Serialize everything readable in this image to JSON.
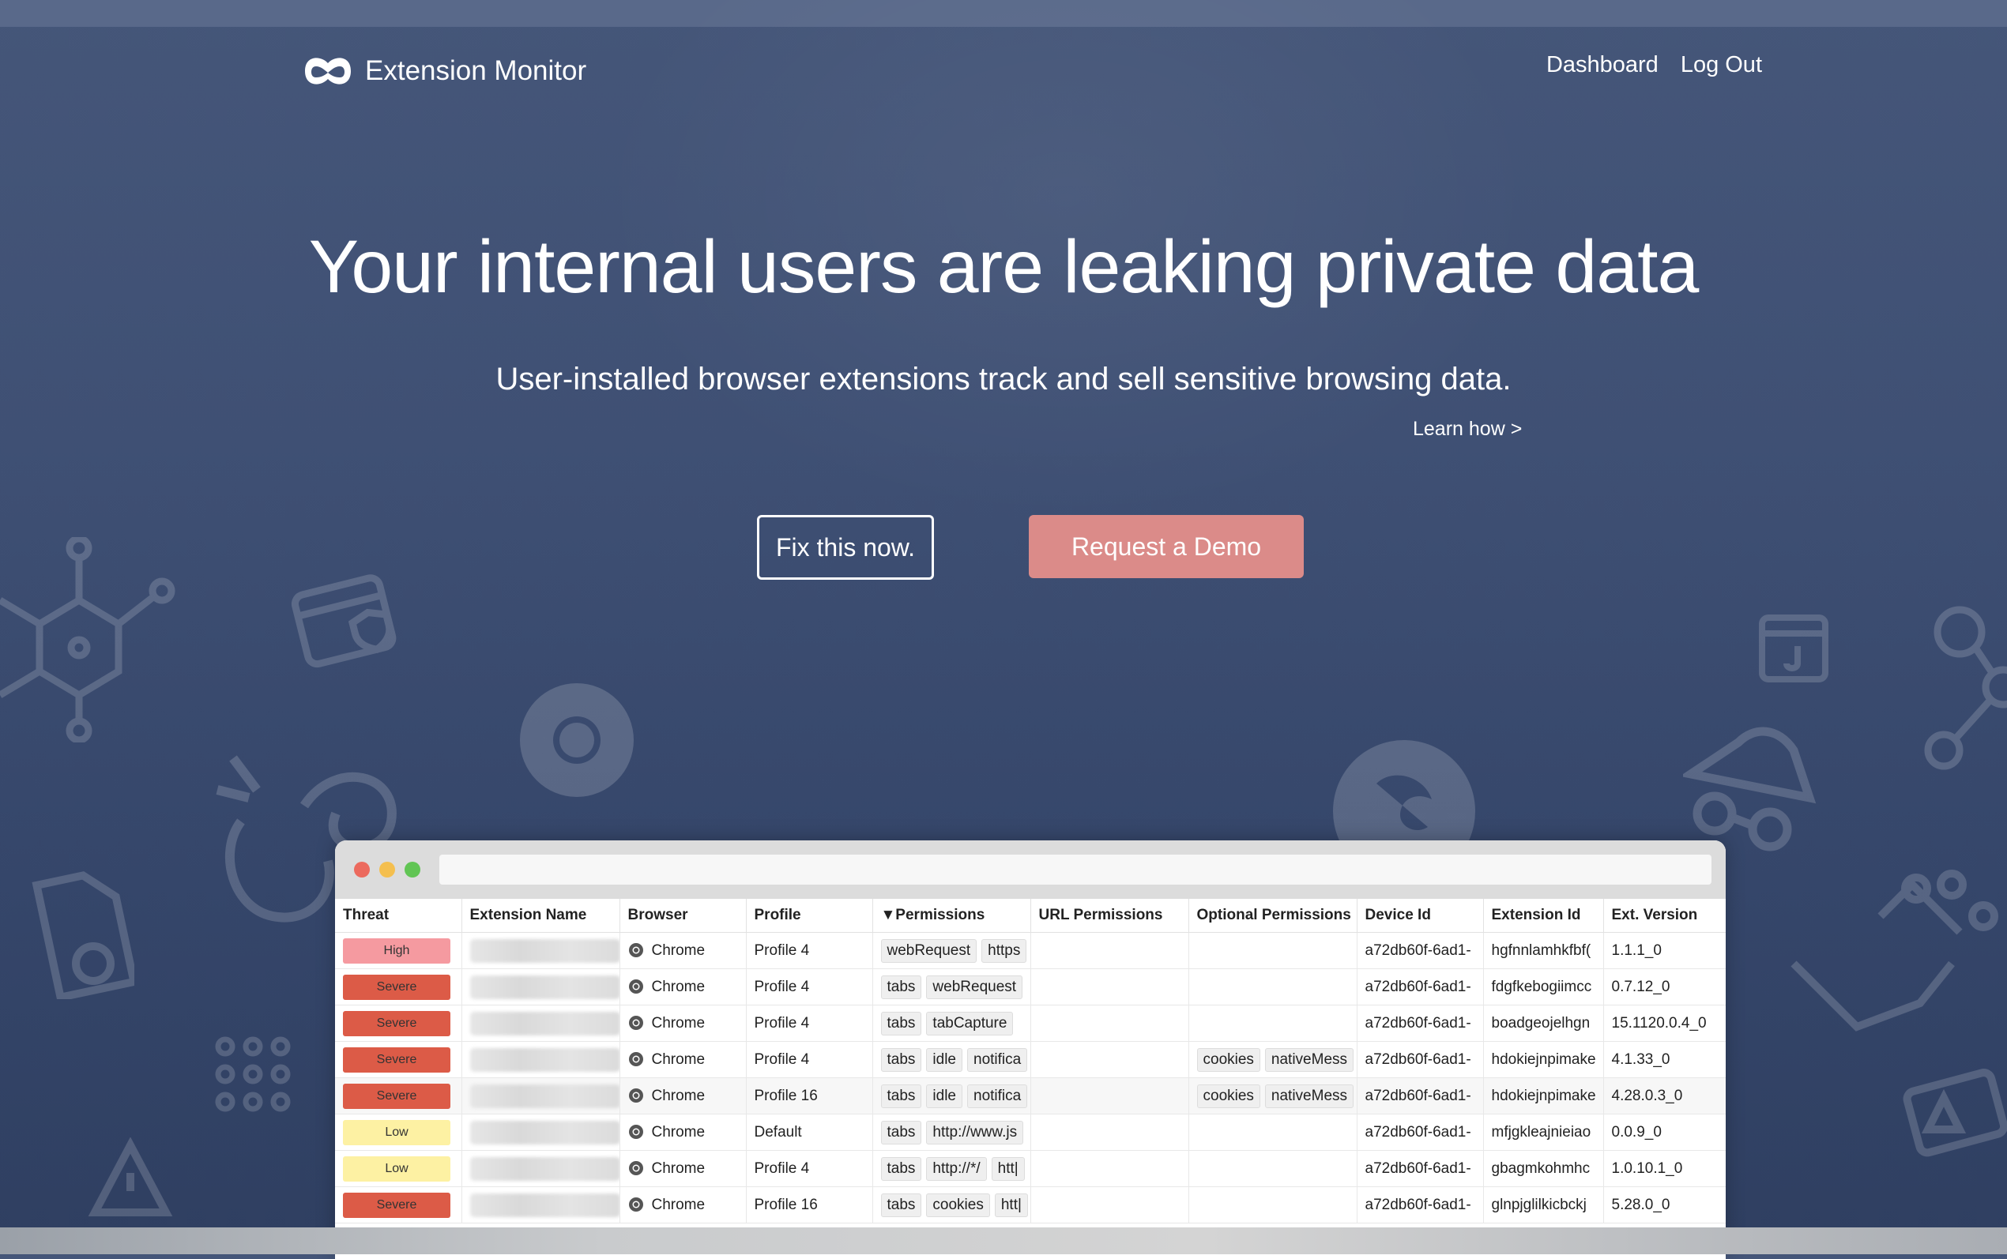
{
  "brand": {
    "name": "Extension Monitor",
    "logo_icon": "infinity-mask-icon"
  },
  "nav": {
    "dashboard": "Dashboard",
    "logout": "Log Out"
  },
  "hero": {
    "title": "Your internal users are leaking private data",
    "subtitle": "User-installed browser extensions track and sell sensitive browsing data.",
    "learn_link": "Learn how >",
    "primary_button": "Fix this now.",
    "secondary_button": "Request a Demo"
  },
  "colors": {
    "background": "#3f5074",
    "demo_button": "#db8b89",
    "threat_high": "#f59aa0",
    "threat_severe": "#dc5b47",
    "threat_low": "#fdf1a3",
    "traffic_red": "#ec6a5e",
    "traffic_yellow": "#f4bf4f",
    "traffic_green": "#61c554"
  },
  "table": {
    "headers": [
      "Threat",
      "Extension Name",
      "Browser",
      "Profile",
      "▼Permissions",
      "URL Permissions",
      "Optional Permissions",
      "Device Id",
      "Extension Id",
      "Ext. Version"
    ],
    "rows": [
      {
        "threat": "High",
        "browser": "Chrome",
        "profile": "Profile 4",
        "permissions": [
          "webRequest",
          "https"
        ],
        "url_permissions": "",
        "optional_permissions": [],
        "device_id": "a72db60f-6ad1-",
        "extension_id": "hgfnnlamhkfbf(",
        "version": "1.1.1_0"
      },
      {
        "threat": "Severe",
        "browser": "Chrome",
        "profile": "Profile 4",
        "permissions": [
          "tabs",
          "webRequest"
        ],
        "url_permissions": "",
        "optional_permissions": [],
        "device_id": "a72db60f-6ad1-",
        "extension_id": "fdgfkebogiimcc",
        "version": "0.7.12_0"
      },
      {
        "threat": "Severe",
        "browser": "Chrome",
        "profile": "Profile 4",
        "permissions": [
          "tabs",
          "tabCapture"
        ],
        "url_permissions": "",
        "optional_permissions": [],
        "device_id": "a72db60f-6ad1-",
        "extension_id": "boadgeojelhgn",
        "version": "15.1120.0.4_0"
      },
      {
        "threat": "Severe",
        "browser": "Chrome",
        "profile": "Profile 4",
        "permissions": [
          "tabs",
          "idle",
          "notifica"
        ],
        "url_permissions": "",
        "optional_permissions": [
          "cookies",
          "nativeMess"
        ],
        "device_id": "a72db60f-6ad1-",
        "extension_id": "hdokiejnpimake",
        "version": "4.1.33_0"
      },
      {
        "threat": "Severe",
        "browser": "Chrome",
        "profile": "Profile 16",
        "permissions": [
          "tabs",
          "idle",
          "notifica"
        ],
        "url_permissions": "",
        "optional_permissions": [
          "cookies",
          "nativeMess"
        ],
        "device_id": "a72db60f-6ad1-",
        "extension_id": "hdokiejnpimake",
        "version": "4.28.0.3_0"
      },
      {
        "threat": "Low",
        "browser": "Chrome",
        "profile": "Default",
        "permissions": [
          "tabs",
          "http://www.js"
        ],
        "url_permissions": "",
        "optional_permissions": [],
        "device_id": "a72db60f-6ad1-",
        "extension_id": "mfjgkleajnieiao",
        "version": "0.0.9_0"
      },
      {
        "threat": "Low",
        "browser": "Chrome",
        "profile": "Profile 4",
        "permissions": [
          "tabs",
          "http://*/",
          "htt|"
        ],
        "url_permissions": "",
        "optional_permissions": [],
        "device_id": "a72db60f-6ad1-",
        "extension_id": "gbagmkohmhc",
        "version": "1.0.10.1_0"
      },
      {
        "threat": "Severe",
        "browser": "Chrome",
        "profile": "Profile 16",
        "permissions": [
          "tabs",
          "cookies",
          "htt|"
        ],
        "url_permissions": "",
        "optional_permissions": [],
        "device_id": "a72db60f-6ad1-",
        "extension_id": "glnpjglilkicbckj",
        "version": "5.28.0_0"
      }
    ]
  }
}
